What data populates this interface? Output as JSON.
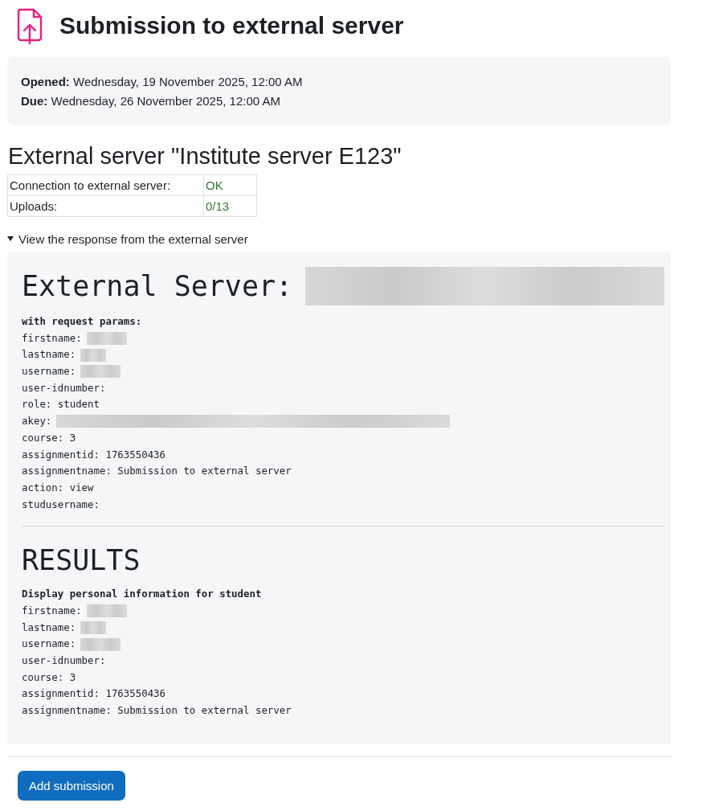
{
  "page_title": "Submission to external server",
  "dates": [
    {
      "label": "Opened:",
      "value": "Wednesday, 19 November 2025, 12:00 AM"
    },
    {
      "label": "Due:",
      "value": "Wednesday, 26 November 2025, 12:00 AM"
    }
  ],
  "server_heading": "External server \"Institute server E123\"",
  "status_table": [
    {
      "label": "Connection to external server:",
      "value": "OK"
    },
    {
      "label": "Uploads:",
      "value": "0/13"
    }
  ],
  "details": {
    "summary": "View the response from the external server",
    "expanded": true
  },
  "response": {
    "heading": "External Server:",
    "heading_redacted": true,
    "subheading": "with request params:",
    "lines": [
      {
        "text": "firstname:",
        "redacted": true,
        "kind": "short"
      },
      {
        "text": "lastname:",
        "redacted": true,
        "kind": "tiny"
      },
      {
        "text": "username:",
        "redacted": true,
        "kind": "short"
      },
      {
        "text": "user-idnumber:"
      },
      {
        "text": "role: student"
      },
      {
        "text": "akey:",
        "redacted": true,
        "kind": "long"
      },
      {
        "text": "course: 3"
      },
      {
        "text": "assignmentid: 1763550436"
      },
      {
        "text": "assignmentname: Submission to external server"
      },
      {
        "text": "action: view"
      },
      {
        "text": "studusername:"
      }
    ],
    "results_heading": "RESULTS",
    "results_subheading": "Display personal information for student",
    "results_lines": [
      {
        "text": "firstname:",
        "redacted": true,
        "kind": "short"
      },
      {
        "text": "lastname:",
        "redacted": true,
        "kind": "tiny"
      },
      {
        "text": "username:",
        "redacted": true,
        "kind": "short"
      },
      {
        "text": "user-idnumber:"
      },
      {
        "text": "course: 3"
      },
      {
        "text": "assignmentid: 1763550436"
      },
      {
        "text": "assignmentname: Submission to external server"
      }
    ]
  },
  "button": "Add submission"
}
